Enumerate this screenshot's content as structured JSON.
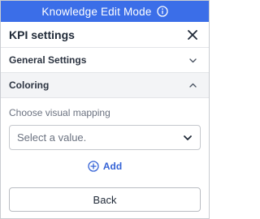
{
  "banner": {
    "text": "Knowledge Edit Mode",
    "icon": "info-icon",
    "color": "#3b6ee8"
  },
  "header": {
    "title": "KPI settings",
    "close_icon": "close-icon"
  },
  "sections": {
    "general": {
      "label": "General Settings",
      "expanded": false
    },
    "coloring": {
      "label": "Coloring",
      "expanded": true
    }
  },
  "coloring": {
    "mapping_label": "Choose visual mapping",
    "select_placeholder": "Select a value.",
    "add_label": "Add",
    "add_icon": "plus-circle-icon"
  },
  "footer": {
    "back_label": "Back"
  }
}
